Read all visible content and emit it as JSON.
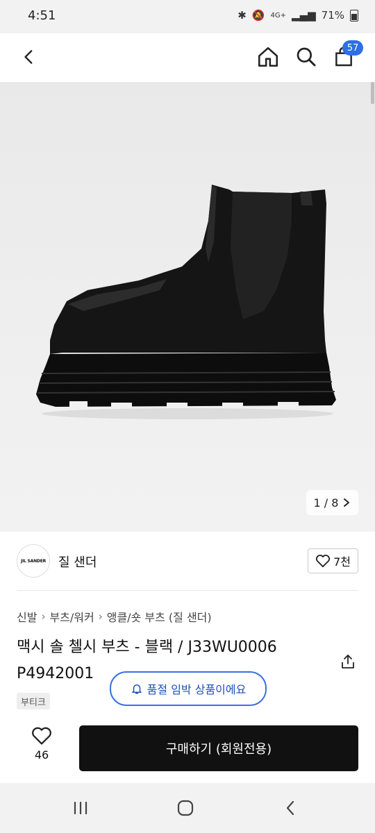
{
  "status_bar": {
    "time": "4:51",
    "network": "4G+",
    "battery": "71%"
  },
  "header": {
    "cart_count": "57"
  },
  "gallery": {
    "counter": "1 / 8"
  },
  "brand": {
    "logo_text": "JIL SANDER",
    "name": "질 샌더",
    "like_count": "7천"
  },
  "breadcrumb": [
    "신발",
    "부츠/워커",
    "앵클/숏 부츠 (질 샌더)"
  ],
  "product": {
    "title_line1": "맥시 솔 첼시 부츠 - 블랙 / J33WU0006",
    "title_line2": "P4942001",
    "tag": "부티크"
  },
  "toast": {
    "text": "품절 임박 상품이에요"
  },
  "bottom_bar": {
    "like_count": "46",
    "buy_label": "구매하기 (회원전용)"
  },
  "colors": {
    "accent": "#2f6fe5",
    "buy_button": "#111111"
  }
}
